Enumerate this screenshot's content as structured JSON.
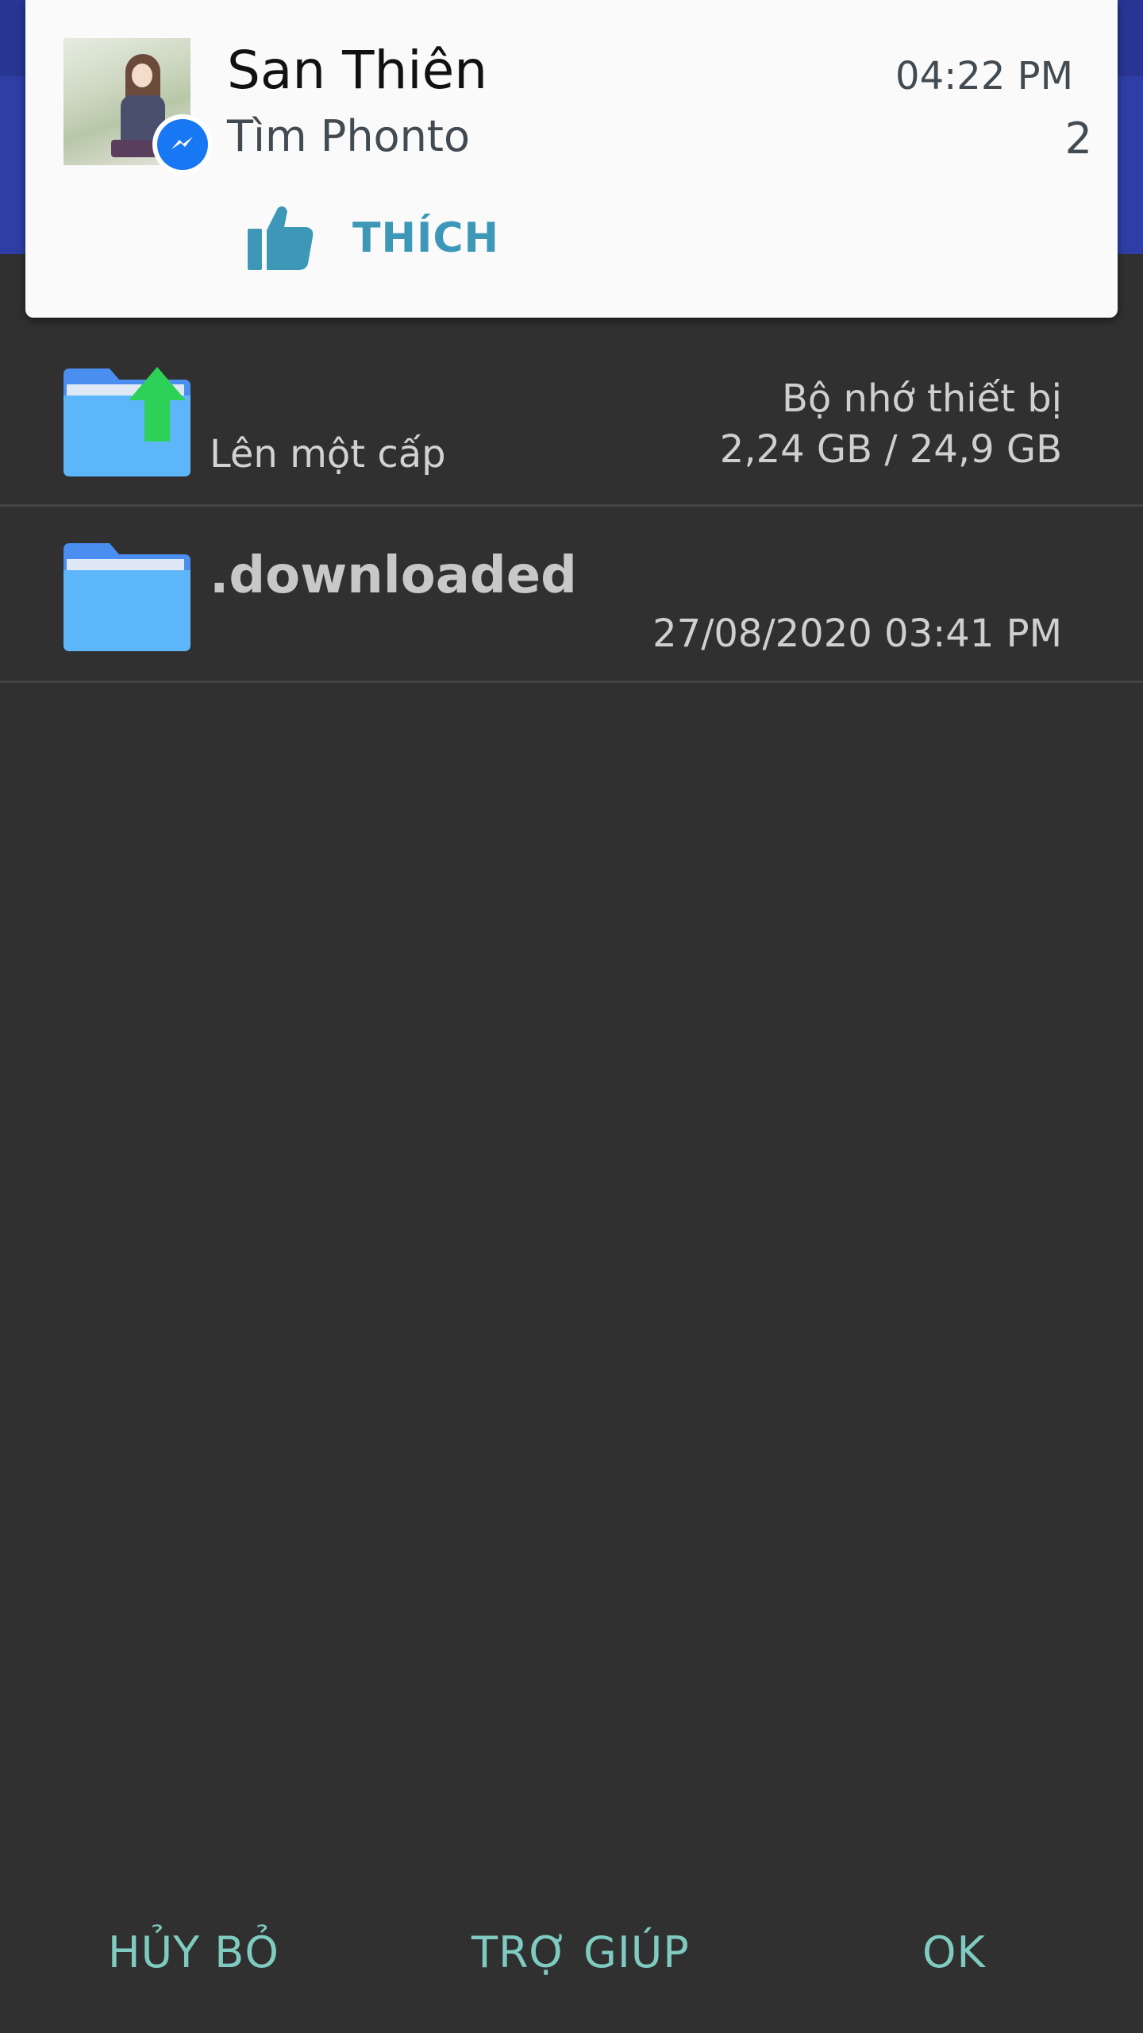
{
  "notification": {
    "sender": "San Thiên",
    "message": "Tìm Phonto",
    "time": "04:22 PM",
    "count": "2",
    "action_label": "THÍCH",
    "app_icon": "messenger-icon",
    "action_icon": "thumbs-up-icon"
  },
  "file_list": {
    "up_row": {
      "label": "Lên một cấp",
      "storage_name": "Bộ nhớ thiết bị",
      "storage_size": "2,24 GB / 24,9 GB",
      "icon": "folder-up-icon"
    },
    "items": [
      {
        "name": ".downloaded",
        "modified": "27/08/2020 03:41 PM",
        "icon": "folder-icon"
      }
    ]
  },
  "buttons": {
    "cancel": "HỦY BỎ",
    "help": "TRỢ GIÚP",
    "ok": "OK"
  },
  "colors": {
    "background": "#303030",
    "appbar": "#2f3ea6",
    "accent_button": "#7fcbc2",
    "like_action": "#3d98b8",
    "folder": "#5cb6f9",
    "up_arrow": "#2ed158"
  }
}
